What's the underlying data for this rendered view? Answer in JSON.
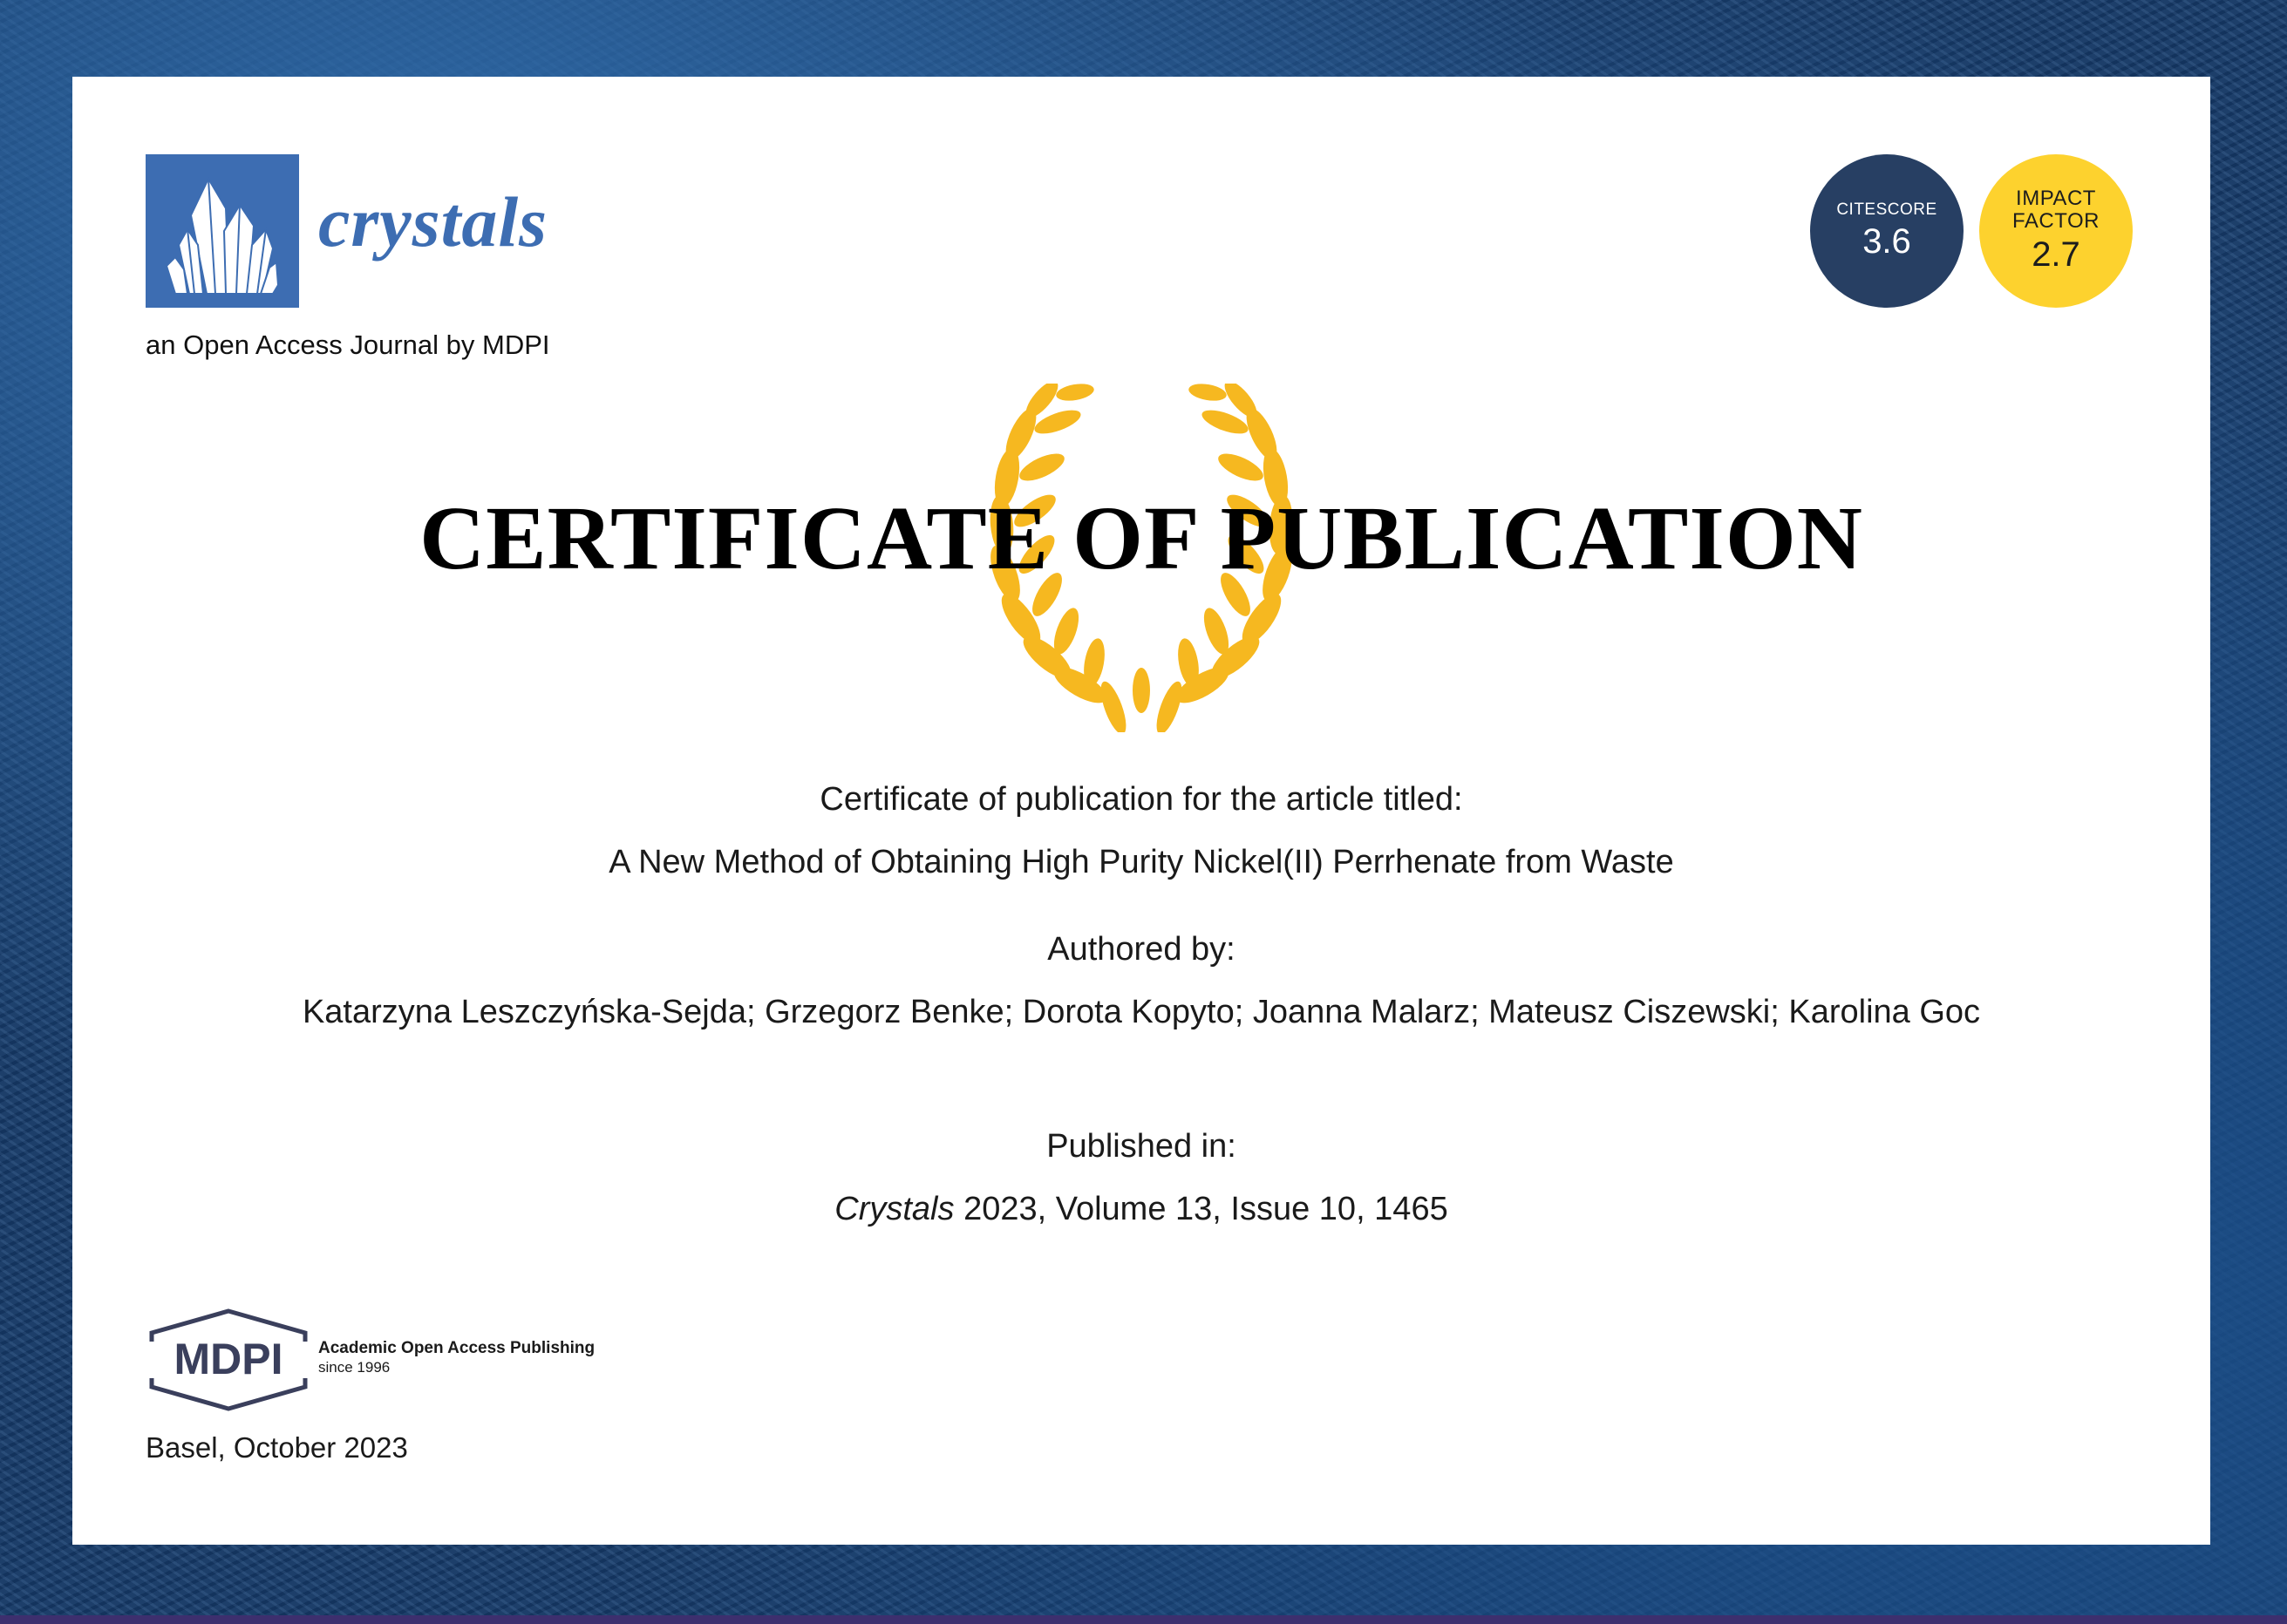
{
  "journal": {
    "name": "crystals",
    "subtitle": "an Open Access Journal by MDPI",
    "logo_icon": "crystal-cluster-icon",
    "brand_color": "#3d6db2"
  },
  "badges": {
    "citescore": {
      "label": "CITESCORE",
      "value": "3.6",
      "color": "#273f63"
    },
    "impact_factor": {
      "label_line1": "IMPACT",
      "label_line2": "FACTOR",
      "value": "2.7",
      "color": "#fdd22e"
    }
  },
  "certificate": {
    "title": "CERTIFICATE OF PUBLICATION",
    "laurel_icon": "laurel-wreath-icon",
    "laurel_color": "#f6b820",
    "intro": "Certificate of publication for the article titled:",
    "article_title": "A New Method of Obtaining High Purity Nickel(II) Perrhenate from Waste",
    "authored_label": "Authored by:",
    "authors": "Katarzyna Leszczyńska-Sejda; Grzegorz Benke; Dorota Kopyto; Joanna Malarz; Mateusz Ciszewski; Karolina Goc",
    "published_label": "Published in:",
    "citation": {
      "journal": "Crystals",
      "year": "2023",
      "rest": ", Volume 13, Issue 10, 1465"
    }
  },
  "publisher": {
    "logo_text": "MDPI",
    "tagline": "Academic Open Access Publishing",
    "since": "since 1996",
    "place_date": "Basel, October 2023"
  }
}
